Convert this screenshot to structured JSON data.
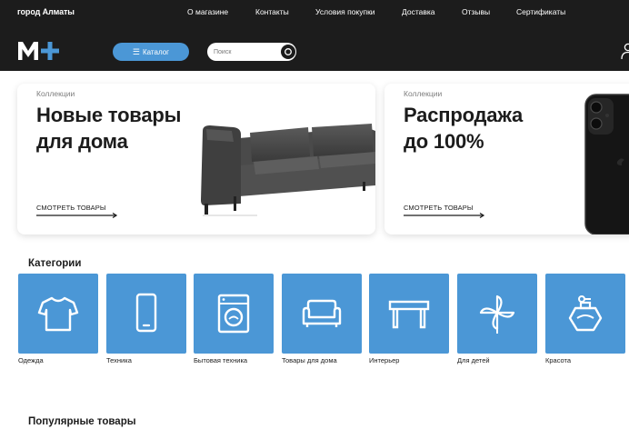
{
  "header": {
    "city": "город Алматы",
    "nav": [
      "О магазине",
      "Контакты",
      "Условия покупки",
      "Доставка",
      "Отзывы",
      "Сертификаты"
    ],
    "catalog_label": "Каталог",
    "search_placeholder": "Поиск",
    "search_value": ""
  },
  "banners": [
    {
      "kicker": "Коллекции",
      "title_line1": "Новые товары",
      "title_line2": "для дома",
      "link": "СМОТРЕТЬ ТОВАРЫ"
    },
    {
      "kicker": "Коллекции",
      "title_line1": "Распродажа",
      "title_line2": "до 100%",
      "link": "СМОТРЕТЬ ТОВАРЫ"
    }
  ],
  "categories_title": "Категории",
  "categories": [
    {
      "label": "Одежда",
      "icon": "tshirt-icon"
    },
    {
      "label": "Техника",
      "icon": "smartphone-icon"
    },
    {
      "label": "Бытовая техника",
      "icon": "washing-machine-icon"
    },
    {
      "label": "Товары для дома",
      "icon": "sofa-icon"
    },
    {
      "label": "Интерьер",
      "icon": "table-icon"
    },
    {
      "label": "Для детей",
      "icon": "pinwheel-icon"
    },
    {
      "label": "Красота",
      "icon": "perfume-icon"
    }
  ],
  "popular_title": "Популярные товары",
  "colors": {
    "header_bg": "#1c1c1c",
    "accent": "#4b97d6",
    "logo_plus": "#4b97d6"
  }
}
